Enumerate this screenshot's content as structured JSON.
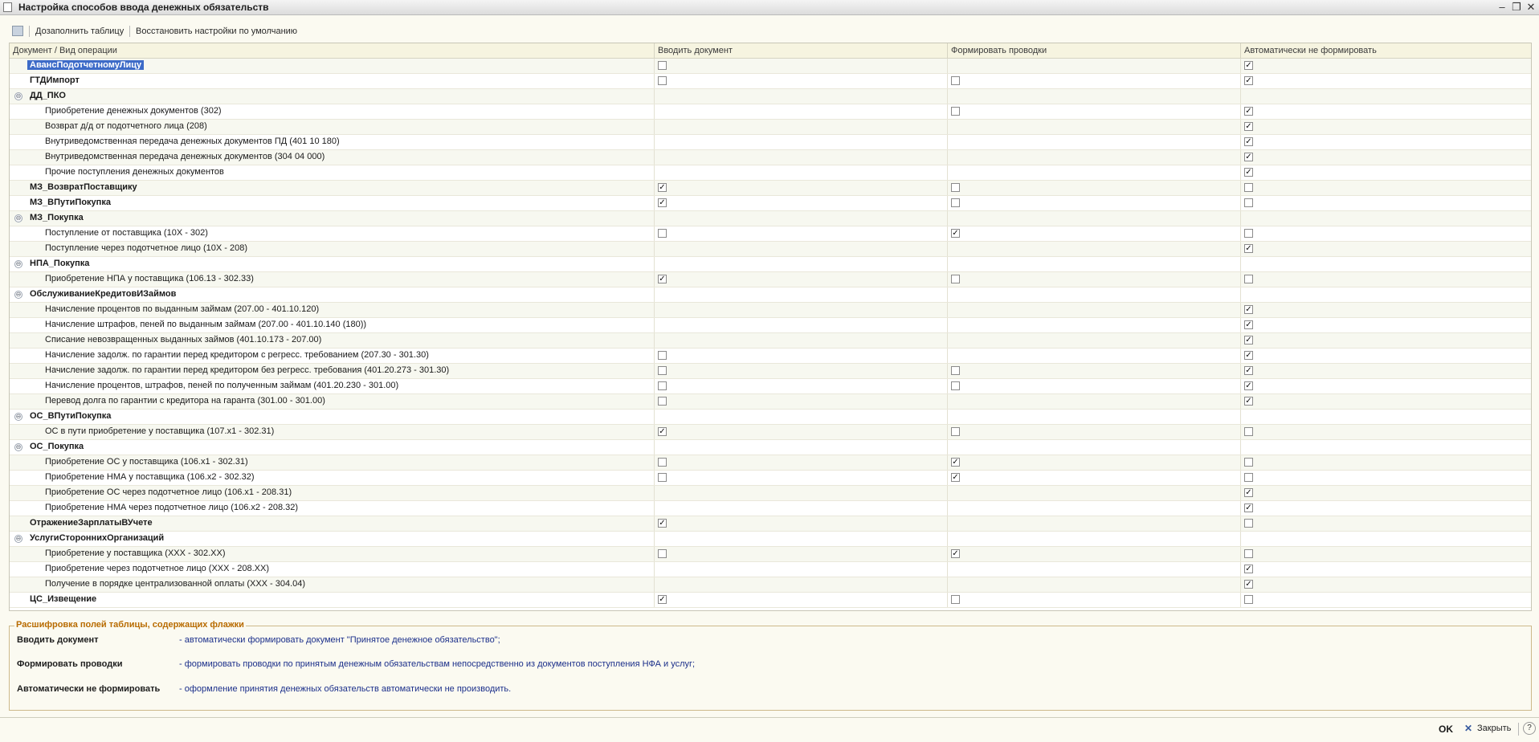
{
  "window": {
    "title": "Настройка способов ввода денежных обязательств",
    "minimize": "–",
    "restore": "❐",
    "close": "✕"
  },
  "toolbar": {
    "fill_table": "Дозаполнить таблицу",
    "restore_defaults": "Восстановить настройки по умолчанию"
  },
  "table": {
    "columns": [
      "Документ / Вид операции",
      "Вводить документ",
      "Формировать проводки",
      "Автоматически не формировать"
    ],
    "rows": [
      {
        "name": "АвансПодотчетномуЛицу",
        "level": 0,
        "selected": true,
        "c1": false,
        "c2": null,
        "c3": true
      },
      {
        "name": "ГТДИмпорт",
        "level": 0,
        "c1": false,
        "c2": false,
        "c3": true
      },
      {
        "name": "ДД_ПКО",
        "level": 0,
        "group": true,
        "c1": null,
        "c2": null,
        "c3": null
      },
      {
        "name": "Приобретение денежных документов (302)",
        "level": 1,
        "c1": null,
        "c2": false,
        "c3": true
      },
      {
        "name": "Возврат д/д от подотчетного лица (208)",
        "level": 1,
        "c1": null,
        "c2": null,
        "c3": true
      },
      {
        "name": "Внутриведомственная передача денежных документов ПД (401 10 180)",
        "level": 1,
        "c1": null,
        "c2": null,
        "c3": true
      },
      {
        "name": "Внутриведомственная передача денежных документов (304 04 000)",
        "level": 1,
        "c1": null,
        "c2": null,
        "c3": true
      },
      {
        "name": "Прочие поступления денежных документов",
        "level": 1,
        "c1": null,
        "c2": null,
        "c3": true
      },
      {
        "name": "МЗ_ВозвратПоставщику",
        "level": 0,
        "c1": true,
        "c2": false,
        "c3": false
      },
      {
        "name": "МЗ_ВПутиПокупка",
        "level": 0,
        "c1": true,
        "c2": false,
        "c3": false
      },
      {
        "name": "МЗ_Покупка",
        "level": 0,
        "group": true,
        "c1": null,
        "c2": null,
        "c3": null
      },
      {
        "name": "Поступление от поставщика (10Х - 302)",
        "level": 1,
        "c1": false,
        "c2": true,
        "c3": false
      },
      {
        "name": "Поступление через подотчетное лицо (10Х - 208)",
        "level": 1,
        "c1": null,
        "c2": null,
        "c3": true
      },
      {
        "name": "НПА_Покупка",
        "level": 0,
        "group": true,
        "c1": null,
        "c2": null,
        "c3": null
      },
      {
        "name": "Приобретение НПА у поставщика (106.13 - 302.33)",
        "level": 1,
        "c1": true,
        "c2": false,
        "c3": false
      },
      {
        "name": "ОбслуживаниеКредитовИЗаймов",
        "level": 0,
        "group": true,
        "c1": null,
        "c2": null,
        "c3": null
      },
      {
        "name": "Начисление процентов по выданным займам (207.00 - 401.10.120)",
        "level": 1,
        "c1": null,
        "c2": null,
        "c3": true
      },
      {
        "name": "Начисление штрафов, пеней по выданным займам (207.00 - 401.10.140 (180))",
        "level": 1,
        "c1": null,
        "c2": null,
        "c3": true
      },
      {
        "name": "Списание невозвращенных выданных займов (401.10.173 - 207.00)",
        "level": 1,
        "c1": null,
        "c2": null,
        "c3": true
      },
      {
        "name": "Начисление задолж. по гарантии перед кредитором с регресс. требованием (207.30 - 301.30)",
        "level": 1,
        "c1": false,
        "c2": null,
        "c3": true
      },
      {
        "name": "Начисление задолж. по гарантии перед кредитором без регресс. требования (401.20.273 - 301.30)",
        "level": 1,
        "c1": false,
        "c2": false,
        "c3": true
      },
      {
        "name": "Начисление процентов, штрафов, пеней по полученным займам (401.20.230 - 301.00)",
        "level": 1,
        "c1": false,
        "c2": false,
        "c3": true
      },
      {
        "name": "Перевод долга по гарантии с кредитора на гаранта (301.00 - 301.00)",
        "level": 1,
        "c1": false,
        "c2": null,
        "c3": true
      },
      {
        "name": "ОС_ВПутиПокупка",
        "level": 0,
        "group": true,
        "c1": null,
        "c2": null,
        "c3": null
      },
      {
        "name": "ОС в пути приобретение у поставщика (107.x1 - 302.31)",
        "level": 1,
        "c1": true,
        "c2": false,
        "c3": false
      },
      {
        "name": "ОС_Покупка",
        "level": 0,
        "group": true,
        "c1": null,
        "c2": null,
        "c3": null
      },
      {
        "name": "Приобретение ОС у поставщика (106.x1 - 302.31)",
        "level": 1,
        "c1": false,
        "c2": true,
        "c3": false
      },
      {
        "name": "Приобретение НМА у поставщика (106.x2 - 302.32)",
        "level": 1,
        "c1": false,
        "c2": true,
        "c3": false
      },
      {
        "name": "Приобретение ОС через подотчетное лицо (106.x1 - 208.31)",
        "level": 1,
        "c1": null,
        "c2": null,
        "c3": true
      },
      {
        "name": "Приобретение НМА через подотчетное лицо (106.x2 - 208.32)",
        "level": 1,
        "c1": null,
        "c2": null,
        "c3": true
      },
      {
        "name": "ОтражениеЗарплатыВУчете",
        "level": 0,
        "c1": true,
        "c2": null,
        "c3": false
      },
      {
        "name": "УслугиСтороннихОрганизаций",
        "level": 0,
        "group": true,
        "c1": null,
        "c2": null,
        "c3": null
      },
      {
        "name": "Приобретение у поставщика (XXX - 302.XX)",
        "level": 1,
        "c1": false,
        "c2": true,
        "c3": false
      },
      {
        "name": "Приобретение через подотчетное лицо (XXX - 208.XX)",
        "level": 1,
        "c1": null,
        "c2": null,
        "c3": true
      },
      {
        "name": "Получение в порядке централизованной оплаты (XXX - 304.04)",
        "level": 1,
        "c1": null,
        "c2": null,
        "c3": true
      },
      {
        "name": "ЦС_Извещение",
        "level": 0,
        "c1": true,
        "c2": false,
        "c3": false
      }
    ]
  },
  "legend": {
    "title": "Расшифровка полей таблицы, содержащих флажки",
    "items": [
      {
        "key": "Вводить документ",
        "text": "- автоматически формировать документ \"Принятое денежное обязательство\";"
      },
      {
        "key": "Формировать проводки",
        "text": "- формировать проводки по принятым денежным обязательствам непосредственно из документов поступления НФА и услуг;"
      },
      {
        "key": "Автоматически не формировать",
        "text": "- оформление принятия денежных обязательств автоматически не производить."
      }
    ]
  },
  "footer": {
    "ok": "OK",
    "close_icon": "✕",
    "close": "Закрыть",
    "help": "?"
  },
  "icons": {
    "collapse_glyph": "⊖",
    "check_glyph": "✓"
  }
}
